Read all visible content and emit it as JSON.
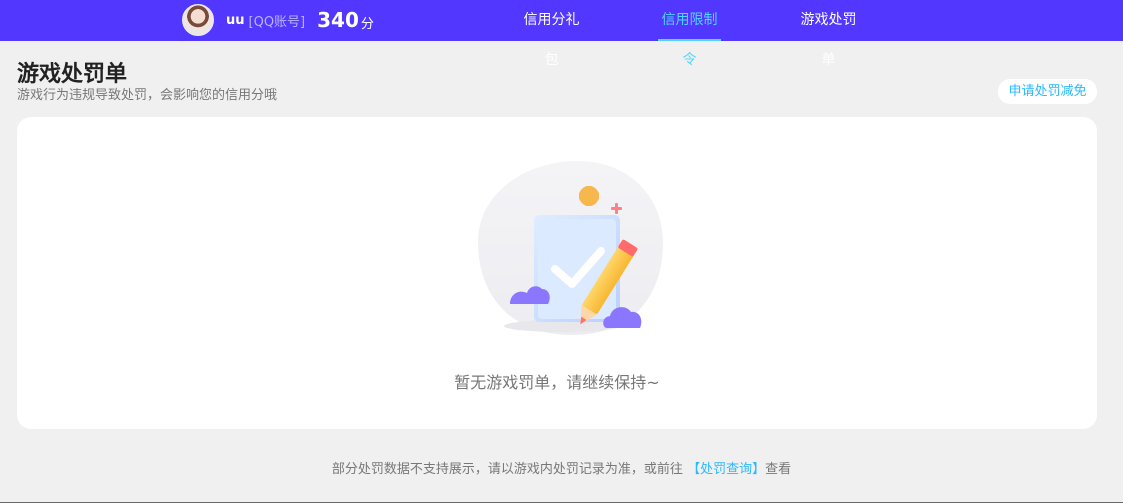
{
  "colors": {
    "header_bg": "#5137ff",
    "active_tab": "#52d6ff",
    "link": "#2bb8ff",
    "page_bg": "#f0f0f0"
  },
  "header": {
    "user": {
      "name": "uu",
      "account_type": "[QQ账号]",
      "score": "340",
      "score_unit": "分",
      "avatar_icon": "avatar-photo"
    },
    "tabs": [
      {
        "label": "信用分礼包",
        "active": false
      },
      {
        "label": "信用限制令",
        "active": true
      },
      {
        "label": "游戏处罚单",
        "active": false
      }
    ]
  },
  "page": {
    "title": "游戏处罚单",
    "subtitle": "游戏行为违规导致处罚，会影响您的信用分哦",
    "apply_button": "申请处罚减免",
    "empty_state": {
      "icon": "empty-clipboard-pencil-illustration",
      "text": "暂无游戏罚单，请继续保持~"
    },
    "footer": {
      "text_before": "部分处罚数据不支持展示，请以游戏内处罚记录为准，或前往",
      "link": "【处罚查询】",
      "text_after": "查看"
    }
  }
}
